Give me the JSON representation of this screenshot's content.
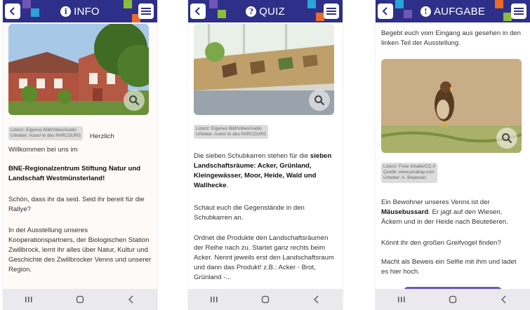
{
  "colors": {
    "header": "#2e2f88",
    "accent_purple": "#6f57b5",
    "accent_blue": "#2aa3d8",
    "accent_green": "#8bbd3b",
    "accent_orange": "#e86b2b"
  },
  "icons": {
    "back": "chevron-left-icon",
    "menu": "hamburger-menu-icon",
    "zoom": "magnifier-icon",
    "nav": [
      "recent-apps-icon",
      "home-icon",
      "back-icon"
    ]
  },
  "screens": [
    {
      "title": "INFO",
      "title_icon": "i",
      "license": [
        "Lizenz: Eigenes Bild/Video/Audio",
        "Urheber: Autor/-in des PARCOURS"
      ],
      "license_tail": "Herzlich",
      "paragraphs": [
        "Willkommen bei uns im",
        "BNE-Regionalzentrum Stiftung Natur und Landschaft Westmünsterland!",
        "Schön, dass ihr da seid. Seid ihr bereit für die Rallye?",
        "In der Ausstellung unseres Kooperationspartners, der Biologischen Station Zwillbrock, lernt ihr alles über Natur, Kultur und Geschichte des Zwillbrocker Venns und unserer Region."
      ]
    },
    {
      "title": "QUIZ",
      "title_icon": "?",
      "license": [
        "Lizenz: Eigenes Bild/Video/Audio",
        "Urheber: Autor/-in des PARCOURS"
      ],
      "p1_start": "Die sieben Schubkarren stehen für die ",
      "p1_bold": "sieben Landschaftsräume: Acker, Grünland, Kleingewässer, Moor, Heide, Wald und Wallhecke",
      "p1_end": ".",
      "p2": "Schaut euch die Gegenstände in den Schubkarren an.",
      "p3": "Ordnet die Produkte den Landschaftsräumen der Reihe nach zu. Startet ganz rechts beim Acker. Nennt jeweils erst den Landschaftsraum und dann das Produkt! z.B.: Acker - Brot, Grünland -..."
    },
    {
      "title": "AUFGABE",
      "title_icon": "!",
      "intro": "Begebt euch vom Eingang aus gesehen in den linken Teil der Ausstellung.",
      "license": [
        "Lizenz: Freie Inhalte/CC-0",
        "Quelle: www.pixabay.com",
        "Urheber: A. Beijeman"
      ],
      "p1_start": "Ein Bewohner unseres Venns ist der ",
      "p1_bold": "Mäusebussard",
      "p1_end": ". Er jagt auf den Wiesen, Äckern und in der Heide nach Beutetieren.",
      "p2": "Könnt ihr den großen Greifvogel finden?",
      "p3": "Macht als Beweis ein Selfie mit ihm und ladet es hier hoch."
    }
  ]
}
